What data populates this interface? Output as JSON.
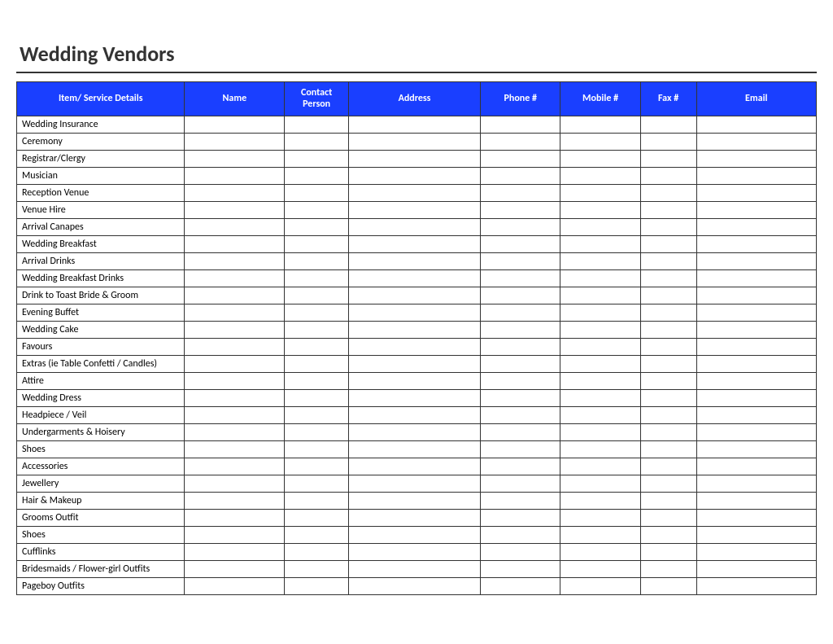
{
  "title": "Wedding Vendors",
  "columns": [
    "Item/ Service Details",
    "Name",
    "Contact Person",
    "Address",
    "Phone #",
    "Mobile #",
    "Fax #",
    "Email"
  ],
  "rows": [
    {
      "item": "Wedding Insurance",
      "name": "",
      "contact": "",
      "address": "",
      "phone": "",
      "mobile": "",
      "fax": "",
      "email": ""
    },
    {
      "item": "Ceremony",
      "name": "",
      "contact": "",
      "address": "",
      "phone": "",
      "mobile": "",
      "fax": "",
      "email": ""
    },
    {
      "item": "Registrar/Clergy",
      "name": "",
      "contact": "",
      "address": "",
      "phone": "",
      "mobile": "",
      "fax": "",
      "email": ""
    },
    {
      "item": "Musician",
      "name": "",
      "contact": "",
      "address": "",
      "phone": "",
      "mobile": "",
      "fax": "",
      "email": ""
    },
    {
      "item": "Reception Venue",
      "name": "",
      "contact": "",
      "address": "",
      "phone": "",
      "mobile": "",
      "fax": "",
      "email": ""
    },
    {
      "item": "Venue Hire",
      "name": "",
      "contact": "",
      "address": "",
      "phone": "",
      "mobile": "",
      "fax": "",
      "email": ""
    },
    {
      "item": "Arrival Canapes",
      "name": "",
      "contact": "",
      "address": "",
      "phone": "",
      "mobile": "",
      "fax": "",
      "email": ""
    },
    {
      "item": "Wedding Breakfast",
      "name": "",
      "contact": "",
      "address": "",
      "phone": "",
      "mobile": "",
      "fax": "",
      "email": ""
    },
    {
      "item": "Arrival Drinks",
      "name": "",
      "contact": "",
      "address": "",
      "phone": "",
      "mobile": "",
      "fax": "",
      "email": ""
    },
    {
      "item": "Wedding Breakfast Drinks",
      "name": "",
      "contact": "",
      "address": "",
      "phone": "",
      "mobile": "",
      "fax": "",
      "email": ""
    },
    {
      "item": "Drink to Toast Bride & Groom",
      "name": "",
      "contact": "",
      "address": "",
      "phone": "",
      "mobile": "",
      "fax": "",
      "email": ""
    },
    {
      "item": "Evening Buffet",
      "name": "",
      "contact": "",
      "address": "",
      "phone": "",
      "mobile": "",
      "fax": "",
      "email": ""
    },
    {
      "item": "Wedding Cake",
      "name": "",
      "contact": "",
      "address": "",
      "phone": "",
      "mobile": "",
      "fax": "",
      "email": ""
    },
    {
      "item": "Favours",
      "name": "",
      "contact": "",
      "address": "",
      "phone": "",
      "mobile": "",
      "fax": "",
      "email": ""
    },
    {
      "item": "Extras (ie Table Confetti / Candles)",
      "name": "",
      "contact": "",
      "address": "",
      "phone": "",
      "mobile": "",
      "fax": "",
      "email": ""
    },
    {
      "item": "Attire",
      "name": "",
      "contact": "",
      "address": "",
      "phone": "",
      "mobile": "",
      "fax": "",
      "email": ""
    },
    {
      "item": "Wedding Dress",
      "name": "",
      "contact": "",
      "address": "",
      "phone": "",
      "mobile": "",
      "fax": "",
      "email": ""
    },
    {
      "item": "Headpiece / Veil",
      "name": "",
      "contact": "",
      "address": "",
      "phone": "",
      "mobile": "",
      "fax": "",
      "email": ""
    },
    {
      "item": "Undergarments & Hoisery",
      "name": "",
      "contact": "",
      "address": "",
      "phone": "",
      "mobile": "",
      "fax": "",
      "email": ""
    },
    {
      "item": "Shoes",
      "name": "",
      "contact": "",
      "address": "",
      "phone": "",
      "mobile": "",
      "fax": "",
      "email": ""
    },
    {
      "item": "Accessories",
      "name": "",
      "contact": "",
      "address": "",
      "phone": "",
      "mobile": "",
      "fax": "",
      "email": ""
    },
    {
      "item": "Jewellery",
      "name": "",
      "contact": "",
      "address": "",
      "phone": "",
      "mobile": "",
      "fax": "",
      "email": ""
    },
    {
      "item": "Hair & Makeup",
      "name": "",
      "contact": "",
      "address": "",
      "phone": "",
      "mobile": "",
      "fax": "",
      "email": ""
    },
    {
      "item": "Grooms Outfit",
      "name": "",
      "contact": "",
      "address": "",
      "phone": "",
      "mobile": "",
      "fax": "",
      "email": ""
    },
    {
      "item": "Shoes",
      "name": "",
      "contact": "",
      "address": "",
      "phone": "",
      "mobile": "",
      "fax": "",
      "email": ""
    },
    {
      "item": "Cufflinks",
      "name": "",
      "contact": "",
      "address": "",
      "phone": "",
      "mobile": "",
      "fax": "",
      "email": ""
    },
    {
      "item": "Bridesmaids / Flower-girl Outfits",
      "name": "",
      "contact": "",
      "address": "",
      "phone": "",
      "mobile": "",
      "fax": "",
      "email": ""
    },
    {
      "item": "Pageboy Outfits",
      "name": "",
      "contact": "",
      "address": "",
      "phone": "",
      "mobile": "",
      "fax": "",
      "email": ""
    }
  ]
}
